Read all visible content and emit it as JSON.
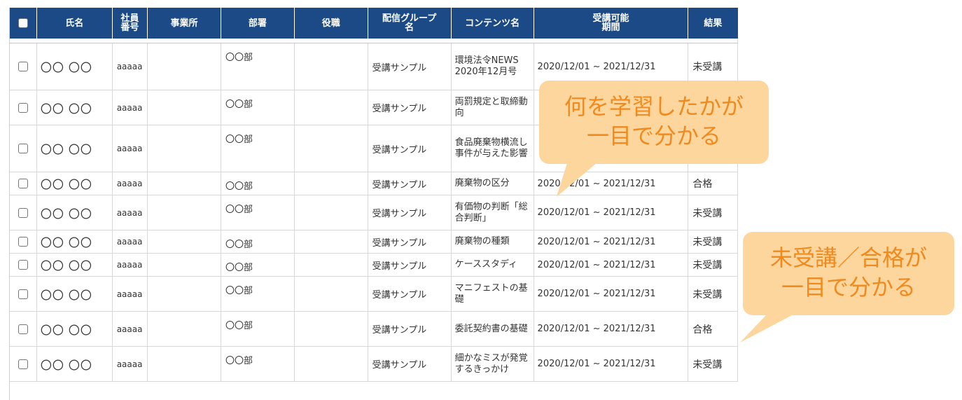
{
  "columns": [
    "",
    "氏名",
    "社員\n番号",
    "事業所",
    "部署",
    "役職",
    "配信グループ\n名",
    "コンテンツ名",
    "受講可能\n期間",
    "結果"
  ],
  "rows": [
    {
      "name": "〇〇 〇〇",
      "employee_no": "aaaaa",
      "office": "",
      "dept": "〇〇部",
      "position": "",
      "group": "受講サンプル",
      "content": "環境法令NEWS 2020年12月号",
      "period": "2020/12/01 ~ 2021/12/31",
      "result": "未受講"
    },
    {
      "name": "〇〇 〇〇",
      "employee_no": "aaaaa",
      "office": "",
      "dept": "〇〇部",
      "position": "",
      "group": "受講サンプル",
      "content": "両罰規定と取締動向",
      "period": "",
      "result": ""
    },
    {
      "name": "〇〇 〇〇",
      "employee_no": "aaaaa",
      "office": "",
      "dept": "〇〇部",
      "position": "",
      "group": "受講サンプル",
      "content": "食品廃棄物横流し事件が与えた影響",
      "period": "",
      "result": ""
    },
    {
      "name": "〇〇 〇〇",
      "employee_no": "aaaaa",
      "office": "",
      "dept": "〇〇部",
      "position": "",
      "group": "受講サンプル",
      "content": "廃棄物の区分",
      "period": "2020/12/01 ~ 2021/12/31",
      "result": "合格"
    },
    {
      "name": "〇〇 〇〇",
      "employee_no": "aaaaa",
      "office": "",
      "dept": "〇〇部",
      "position": "",
      "group": "受講サンプル",
      "content": "有価物の判断「総合判断」",
      "period": "2020/12/01 ~ 2021/12/31",
      "result": "未受講"
    },
    {
      "name": "〇〇 〇〇",
      "employee_no": "aaaaa",
      "office": "",
      "dept": "〇〇部",
      "position": "",
      "group": "受講サンプル",
      "content": "廃棄物の種類",
      "period": "2020/12/01 ~ 2021/12/31",
      "result": "未受講"
    },
    {
      "name": "〇〇 〇〇",
      "employee_no": "aaaaa",
      "office": "",
      "dept": "〇〇部",
      "position": "",
      "group": "受講サンプル",
      "content": "ケーススタディ",
      "period": "2020/12/01 ~ 2021/12/31",
      "result": "未受講"
    },
    {
      "name": "〇〇 〇〇",
      "employee_no": "aaaaa",
      "office": "",
      "dept": "〇〇部",
      "position": "",
      "group": "受講サンプル",
      "content": "マニフェストの基礎",
      "period": "2020/12/01 ~ 2021/12/31",
      "result": "未受講"
    },
    {
      "name": "〇〇 〇〇",
      "employee_no": "aaaaa",
      "office": "",
      "dept": "〇〇部",
      "position": "",
      "group": "受講サンプル",
      "content": "委託契約書の基礎",
      "period": "2020/12/01 ~ 2021/12/31",
      "result": "合格"
    },
    {
      "name": "〇〇 〇〇",
      "employee_no": "aaaaa",
      "office": "",
      "dept": "〇〇部",
      "position": "",
      "group": "受講サンプル",
      "content": "細かなミスが発覚するきっかけ",
      "period": "2020/12/01 ~ 2021/12/31",
      "result": "未受講"
    }
  ],
  "callouts": [
    {
      "text": "何を学習したかが\n一目で分かる"
    },
    {
      "text": "未受講／合格が\n一目で分かる"
    }
  ],
  "colors": {
    "header_bg": "#1b4a86",
    "callout_bg": "#fdd69e",
    "callout_text": "#ef8a1e"
  }
}
